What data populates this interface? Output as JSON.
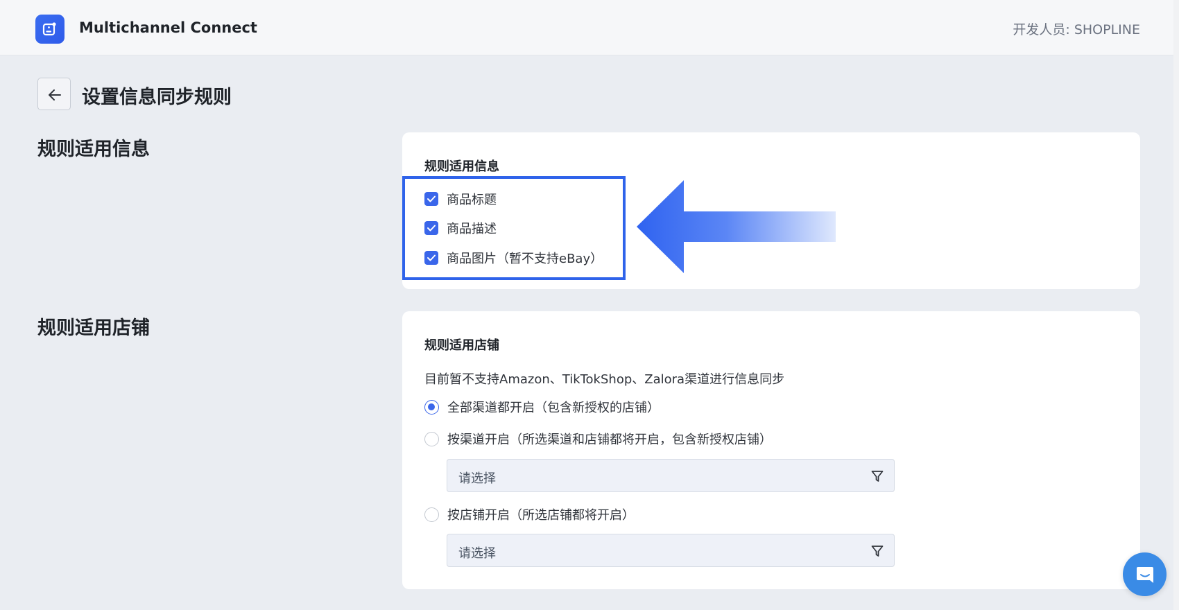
{
  "header": {
    "app_name": "Multichannel Connect",
    "developer": "开发人员: SHOPLINE",
    "logo_icon": "app-logo-icon"
  },
  "page": {
    "title": "设置信息同步规则",
    "back_icon": "arrow-left-icon"
  },
  "info_section": {
    "label": "规则适用信息",
    "card_title": "规则适用信息",
    "options": [
      {
        "label": "商品标题",
        "checked": true
      },
      {
        "label": "商品描述",
        "checked": true
      },
      {
        "label": "商品图片（暂不支持eBay）",
        "checked": true
      }
    ]
  },
  "store_section": {
    "label": "规则适用店铺",
    "card_title": "规则适用店铺",
    "notice": "目前暂不支持Amazon、TikTokShop、Zalora渠道进行信息同步",
    "radio_all": {
      "label": "全部渠道都开启（包含新授权的店铺）",
      "checked": true
    },
    "radio_channel": {
      "label": "按渠道开启（所选渠道和店铺都将开启，包含新授权店铺）",
      "checked": false
    },
    "channel_select": {
      "placeholder": "请选择"
    },
    "radio_store": {
      "label": "按店铺开启（所选店铺都将开启）",
      "checked": false
    },
    "store_select": {
      "placeholder": "请选择"
    }
  },
  "colors": {
    "accent": "#3a66ea",
    "highlight": "#2f63ea",
    "chat": "#3a8be6"
  }
}
